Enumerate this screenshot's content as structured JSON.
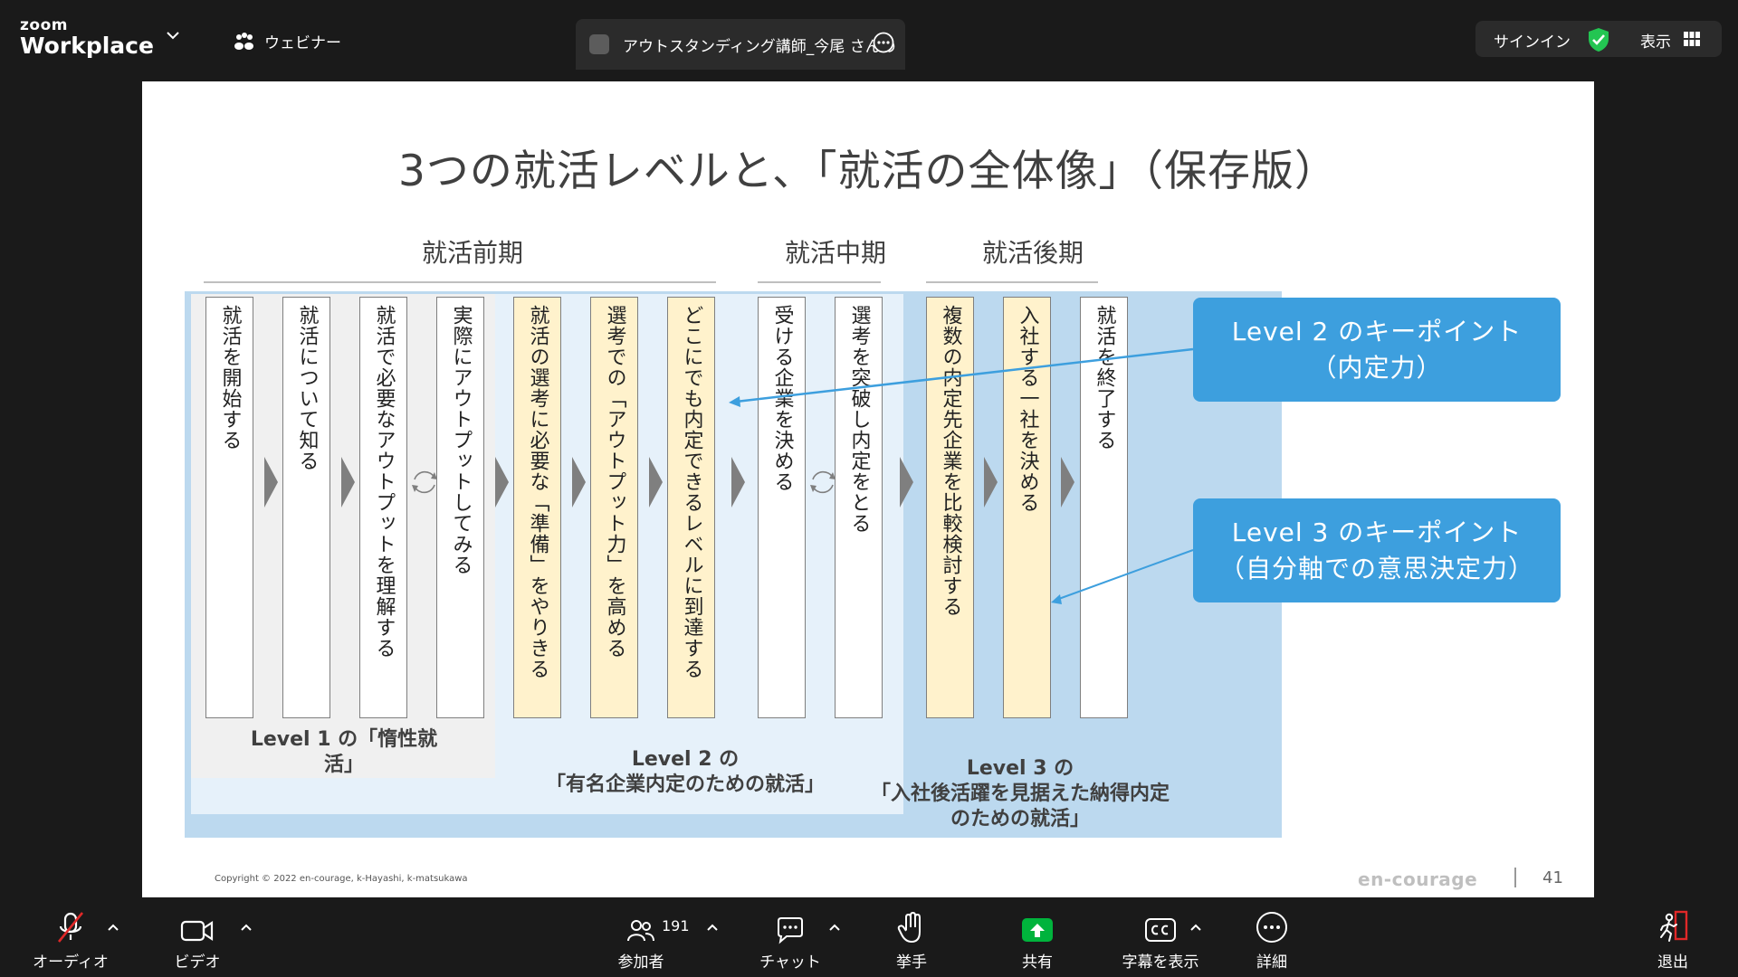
{
  "topbar": {
    "logo_small": "zoom",
    "logo_big": "Workplace",
    "webinar_label": "ウェビナー",
    "meeting_title": "アウトスタンディング講師_今尾 さんの",
    "signin_label": "サインイン",
    "view_label": "表示"
  },
  "slide": {
    "title": "3つの就活レベルと、「就活の全体像」（保存版）",
    "phases": {
      "early": "就活前期",
      "middle": "就活中期",
      "late": "就活後期"
    },
    "steps": [
      "就活を開始する",
      "就活について知る",
      "就活で必要なアウトプットを理解する",
      "実際にアウトプットしてみる",
      "就活の選考に必要な「準備」をやりきる",
      "選考での「アウトプット力」を高める",
      "どこにでも内定できるレベルに到達する",
      "受ける企業を決める",
      "選考を突破し内定をとる",
      "複数の内定先企業を比較検討する",
      "入社する一社を決める",
      "就活を終了する"
    ],
    "levels": {
      "l1_line1": "Level 1 の「惰性就",
      "l1_line2": "活」",
      "l2_line1": "Level 2 の",
      "l2_line2": "「有名企業内定のための就活」",
      "l3_line1": "Level 3 の",
      "l3_line2": "「入社後活躍を見据えた納得内定",
      "l3_line3": "のための就活」"
    },
    "keypoints": {
      "kp2_line1": "Level 2 のキーポイント",
      "kp2_line2": "（内定力）",
      "kp3_line1": "Level 3 のキーポイント",
      "kp3_line2": "（自分軸での意思決定力）"
    },
    "copyright": "Copyright © 2022 en-courage, k-Hayashi, k-matsukawa",
    "brand": "en-courage",
    "page_number": "41"
  },
  "toolbar": {
    "audio": "オーディオ",
    "video": "ビデオ",
    "participants": "参加者",
    "participant_count": "191",
    "chat": "チャット",
    "raise_hand": "挙手",
    "share": "共有",
    "captions": "字幕を表示",
    "more": "詳細",
    "leave": "退出"
  },
  "colors": {
    "accent_blue": "#3d9fde",
    "share_green": "#00b33c",
    "step_yellow": "#fff2cc",
    "level3_bg": "#bcd9ef",
    "level2_bg": "#e6f1fa",
    "level1_bg": "#f0f0f0"
  },
  "icons": [
    "gear-icon",
    "paw-icon",
    "more-icon",
    "shield-check-icon",
    "grid-icon",
    "mic-muted-icon",
    "video-icon",
    "participants-icon",
    "chat-icon",
    "hand-icon",
    "share-icon",
    "cc-icon",
    "more-icon",
    "leave-icon"
  ]
}
